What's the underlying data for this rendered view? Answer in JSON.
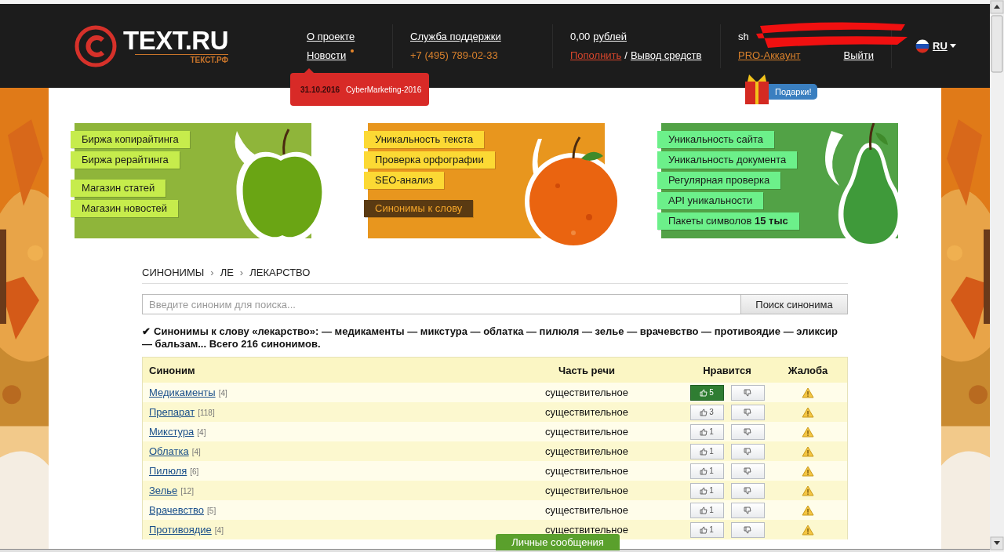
{
  "header": {
    "logo": {
      "title": "TEXT.RU",
      "subtitle": "ТЕКСТ.РФ"
    },
    "nav": [
      {
        "label": "О проекте",
        "has_update": false
      },
      {
        "label": "Новости",
        "has_update": true
      }
    ],
    "support": {
      "label": "Служба поддержки",
      "phone": "+7 (495) 789-02-33"
    },
    "balance": {
      "amount": "0,00",
      "unit": "рублей",
      "topup": "Пополнить",
      "separator": "/",
      "withdraw": "Вывод средств"
    },
    "account": {
      "username": "sh",
      "pro": "PRO-Аккаунт",
      "logout": "Выйти"
    },
    "language": "RU",
    "news_popup": {
      "date": "31.10.2016",
      "title": "CyberMarketing-2016"
    },
    "gifts": "Подарки!"
  },
  "banners": [
    {
      "kind": "apple",
      "groups": [
        [
          {
            "label": "Биржа копирайтинга",
            "selected": false
          },
          {
            "label": "Биржа рерайтинга",
            "selected": false
          }
        ],
        [
          {
            "label": "Магазин статей",
            "selected": false
          },
          {
            "label": "Магазин новостей",
            "selected": false
          }
        ]
      ]
    },
    {
      "kind": "orange",
      "groups": [
        [
          {
            "label": "Уникальность текста",
            "selected": false
          },
          {
            "label": "Проверка орфографии",
            "selected": false
          },
          {
            "label": "SEO-анализ",
            "selected": false
          }
        ],
        [
          {
            "label": "Синонимы к слову",
            "selected": true
          }
        ]
      ]
    },
    {
      "kind": "pear",
      "groups": [
        [
          {
            "label": "Уникальность сайта",
            "selected": false
          },
          {
            "label": "Уникальность документа",
            "selected": false
          },
          {
            "label": "Регулярная проверка",
            "selected": false
          },
          {
            "label": "API уникальности",
            "selected": false
          },
          {
            "label": "Пакеты символов **15 тыс**",
            "selected": false
          }
        ]
      ]
    }
  ],
  "breadcrumb": {
    "separator": "›",
    "items": [
      "СИНОНИМЫ",
      "ЛЕ",
      "ЛЕКАРСТВО"
    ]
  },
  "search": {
    "placeholder": "Введите синоним для поиска...",
    "button": "Поиск синонима"
  },
  "summary": {
    "check": "✔",
    "text": "Синонимы к слову «лекарство»: — медикаменты — микстура — облатка — пилюля — зелье — врачевство — противоядие — эликсир — бальзам... Всего 216 синонимов."
  },
  "table": {
    "columns": [
      "Синоним",
      "Часть речи",
      "Нравится",
      "Жалоба"
    ],
    "rows": [
      {
        "word": "Медикаменты",
        "count": "[4]",
        "part": "существительное",
        "likes": "5",
        "liked": true
      },
      {
        "word": "Препарат",
        "count": "[118]",
        "part": "существительное",
        "likes": "3",
        "liked": false
      },
      {
        "word": "Микстура",
        "count": "[4]",
        "part": "существительное",
        "likes": "1",
        "liked": false
      },
      {
        "word": "Облатка",
        "count": "[4]",
        "part": "существительное",
        "likes": "1",
        "liked": false
      },
      {
        "word": "Пилюля",
        "count": "[6]",
        "part": "существительное",
        "likes": "1",
        "liked": false
      },
      {
        "word": "Зелье",
        "count": "[12]",
        "part": "существительное",
        "likes": "1",
        "liked": false
      },
      {
        "word": "Врачевство",
        "count": "[5]",
        "part": "существительное",
        "likes": "1",
        "liked": false
      },
      {
        "word": "Противоядие",
        "count": "[4]",
        "part": "существительное",
        "likes": "1",
        "liked": false
      }
    ]
  },
  "messages_tab": "Личные сообщения"
}
